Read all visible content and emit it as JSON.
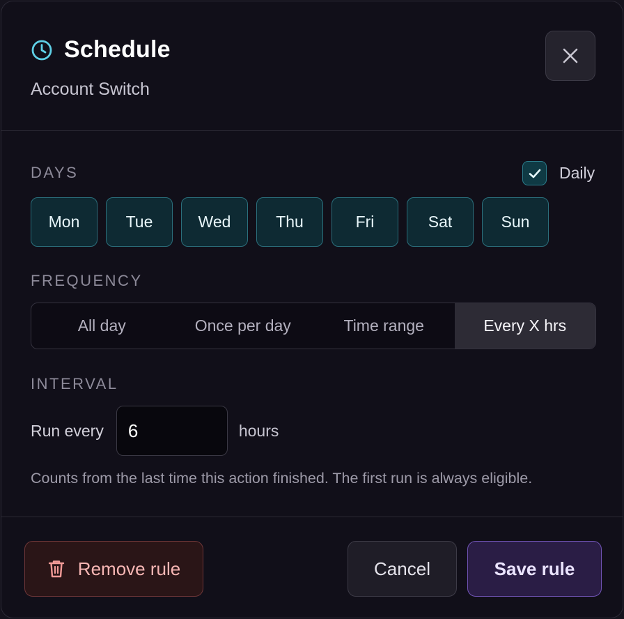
{
  "dialog": {
    "title": "Schedule",
    "subtitle": "Account Switch",
    "close_icon": "close-icon",
    "title_icon": "clock-icon"
  },
  "days": {
    "label": "DAYS",
    "daily_label": "Daily",
    "daily_checked": true,
    "items": [
      {
        "label": "Mon",
        "selected": true
      },
      {
        "label": "Tue",
        "selected": true
      },
      {
        "label": "Wed",
        "selected": true
      },
      {
        "label": "Thu",
        "selected": true
      },
      {
        "label": "Fri",
        "selected": true
      },
      {
        "label": "Sat",
        "selected": true
      },
      {
        "label": "Sun",
        "selected": true
      }
    ]
  },
  "frequency": {
    "label": "FREQUENCY",
    "options": [
      "All day",
      "Once per day",
      "Time range",
      "Every X hrs"
    ],
    "selected": "Every X hrs"
  },
  "interval": {
    "label": "INTERVAL",
    "run_label": "Run every",
    "value": "6",
    "unit": "hours",
    "hint": "Counts from the last time this action finished. The first run is always eligible."
  },
  "footer": {
    "remove_label": "Remove rule",
    "remove_icon": "trash-icon",
    "cancel_label": "Cancel",
    "save_label": "Save rule"
  },
  "colors": {
    "accent_teal": "#5fd0e6",
    "accent_purple": "#7154b6",
    "danger": "#f7b6b4"
  }
}
